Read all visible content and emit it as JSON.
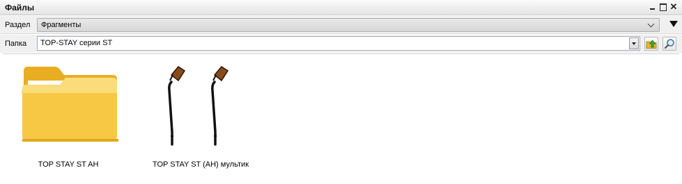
{
  "window": {
    "title": "Файлы"
  },
  "icons": {
    "minimize": "minimize-icon",
    "maximize": "maximize-icon",
    "close": "close-icon",
    "folder_up": "folder-up-icon",
    "search": "search-icon"
  },
  "section": {
    "label": "Раздел",
    "value": "Фрагменты"
  },
  "folder": {
    "label": "Папка",
    "value": "TOP-STAY серии ST"
  },
  "files": [
    {
      "name": "TOP STAY ST AH",
      "kind": "folder",
      "icon": "folder-icon"
    },
    {
      "name": "TOP STAY ST (AH)  мультик",
      "kind": "fragment",
      "icon": "fragment-thumbnail"
    }
  ],
  "colors": {
    "folder_yellow": "#f5c43a",
    "folder_light": "#fde9a0",
    "fragment_brown": "#8a4b1c"
  }
}
